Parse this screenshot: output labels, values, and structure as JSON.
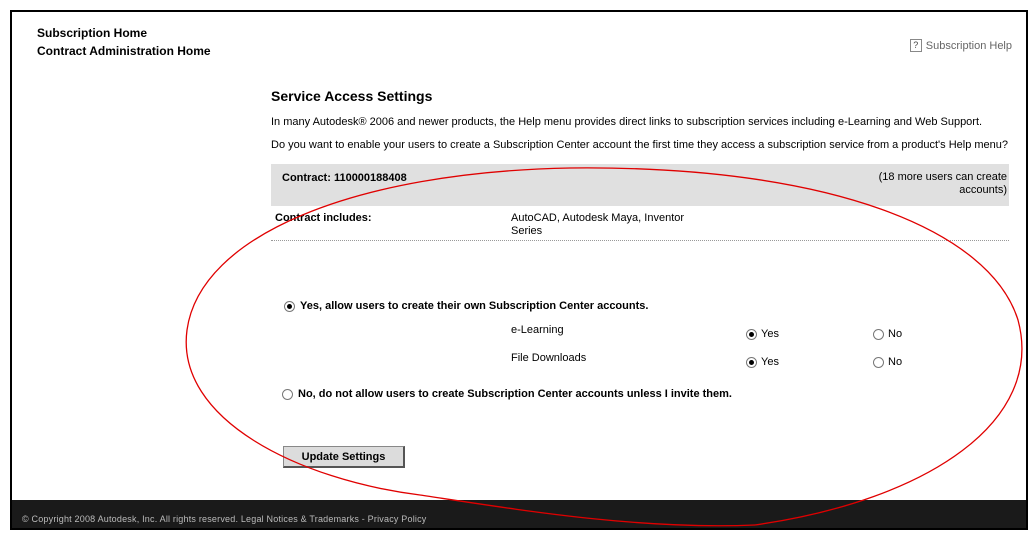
{
  "nav": {
    "subscription_home": "Subscription Home",
    "contract_admin_home": "Contract Administration Home"
  },
  "help": {
    "icon_glyph": "?",
    "label": "Subscription Help"
  },
  "page": {
    "title": "Service Access Settings",
    "intro": "In many Autodesk® 2006 and newer products, the Help menu provides direct links to subscription services including e-Learning and Web Support.",
    "question": "Do you want to enable your users to create a Subscription Center account the first time they access a subscription service from a product's Help menu?"
  },
  "contract": {
    "id_label": "Contract: 110000188408",
    "more_users": "(18 more users can create accounts)",
    "includes_label": "Contract includes:",
    "includes_value": "AutoCAD, Autodesk Maya, Inventor Series"
  },
  "options": {
    "allow": {
      "label": "Yes, allow users to create their own Subscription Center accounts.",
      "selected": true
    },
    "deny": {
      "label": "No, do not allow users to create Subscription Center accounts unless I invite them.",
      "selected": false
    }
  },
  "services": [
    {
      "name": "e-Learning",
      "yes": "Yes",
      "no": "No",
      "value": "Yes"
    },
    {
      "name": "File Downloads",
      "yes": "Yes",
      "no": "No",
      "value": "Yes"
    }
  ],
  "button": {
    "update_label": "Update Settings"
  },
  "footer": {
    "text": "© Copyright 2008 Autodesk, Inc. All rights reserved. Legal Notices & Trademarks - Privacy Policy"
  },
  "colors": {
    "annotation": "#e00000",
    "footer_bg": "#1a1a1a",
    "contract_bar": "#e0e0e0"
  }
}
